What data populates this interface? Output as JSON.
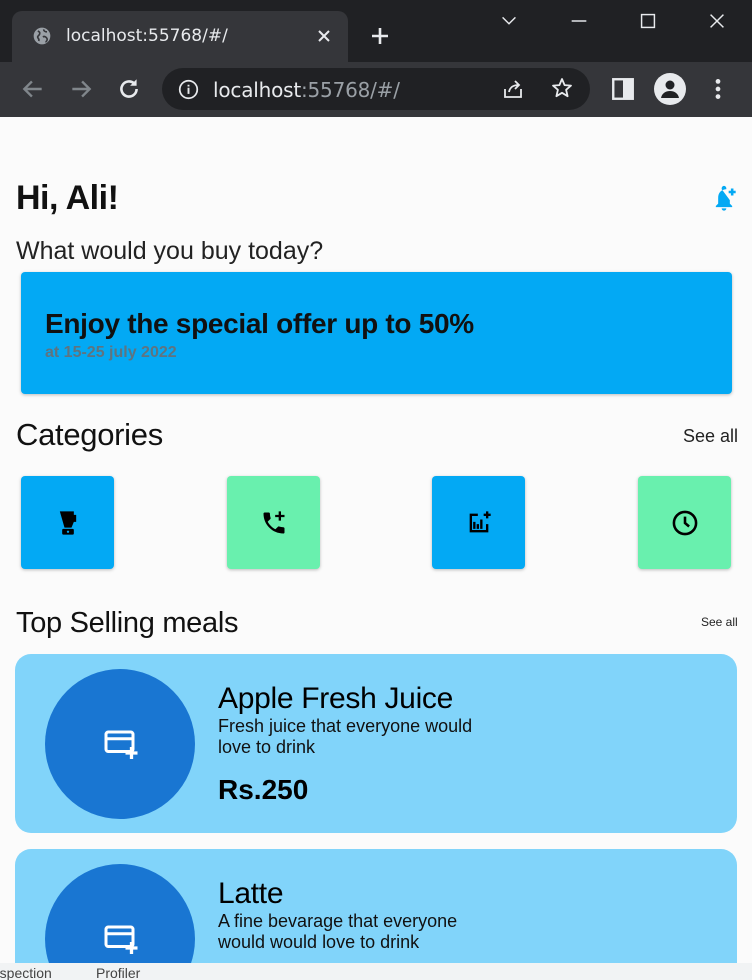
{
  "browser": {
    "tab_title": "localhost:55768/#/",
    "url_host": "localhost",
    "url_rest": ":55768/#/"
  },
  "app": {
    "greeting": "Hi, Ali!",
    "subtitle": "What would you buy today?",
    "offer": {
      "title": "Enjoy the special offer up to 50%",
      "date": "at 15-25 july 2022"
    },
    "categories": {
      "title": "Categories",
      "see_all": "See all",
      "items": [
        {
          "icon": "blender-icon",
          "color": "#03a9f4"
        },
        {
          "icon": "add-call-icon",
          "color": "#69f0ae"
        },
        {
          "icon": "add-chart-icon",
          "color": "#03a9f4"
        },
        {
          "icon": "clock-icon",
          "color": "#69f0ae"
        }
      ]
    },
    "top_selling": {
      "title": "Top Selling meals",
      "see_all": "See all",
      "meals": [
        {
          "name": "Apple Fresh Juice",
          "desc": "Fresh juice that everyone would love to drink",
          "price": "Rs.250",
          "icon": "add-card-icon"
        },
        {
          "name": "Latte",
          "desc": "A fine bevarage that everyone would would love to drink",
          "icon": "add-card-icon"
        }
      ]
    }
  },
  "devtools": {
    "tab1": "Inspection",
    "tab2": "Profiler"
  },
  "colors": {
    "primary": "#03a9f4",
    "accent": "#69f0ae",
    "card": "#81d4fa",
    "meal_circle": "#1976d2"
  }
}
